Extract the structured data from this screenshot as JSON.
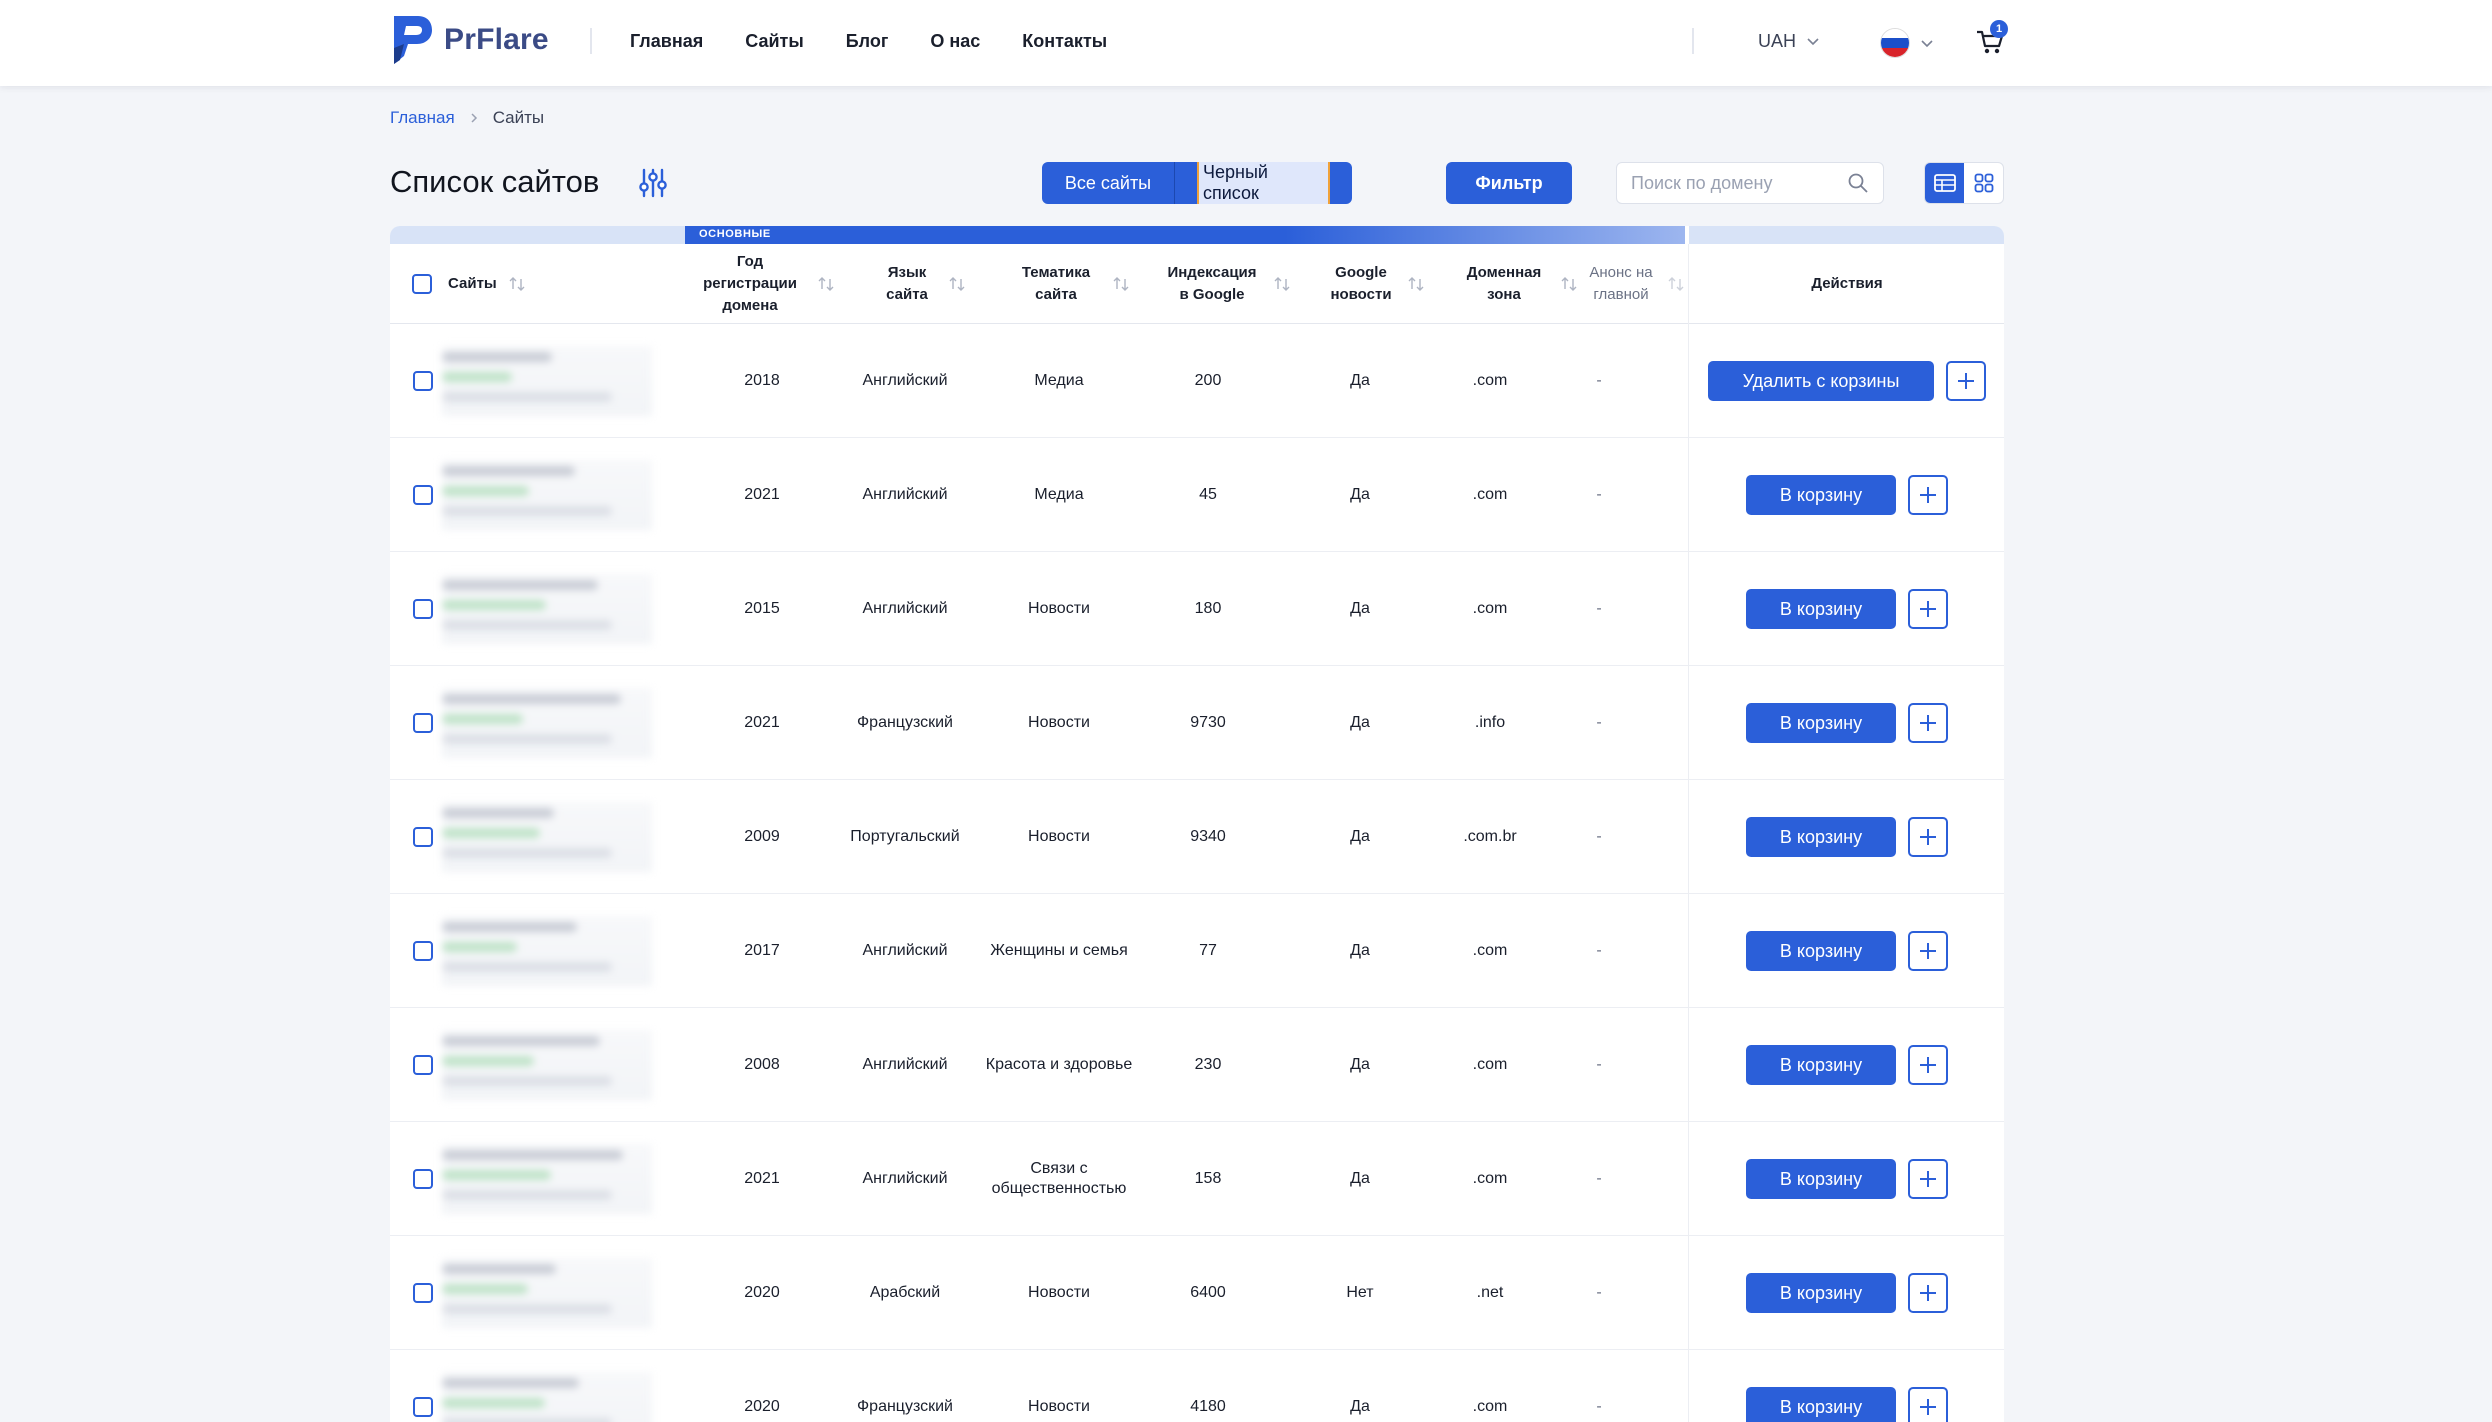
{
  "brand": {
    "name": "PrFlare",
    "accent": "#2b5fd9"
  },
  "nav": [
    "Главная",
    "Сайты",
    "Блог",
    "О нас",
    "Контакты"
  ],
  "currency": "UAH",
  "cart": {
    "count": "1"
  },
  "breadcrumb": {
    "home": "Главная",
    "current": "Сайты"
  },
  "page": {
    "title": "Список сайтов"
  },
  "tabs": {
    "all": "Все сайты",
    "blacklist": "Черный список"
  },
  "filter_label": "Фильтр",
  "search": {
    "placeholder": "Поиск по домену"
  },
  "table": {
    "band_label": "ОСНОВНЫЕ",
    "headers": {
      "sites": "Сайты",
      "reg_year": "Год регистрации домена",
      "language": "Язык сайта",
      "topic": "Тематика сайта",
      "indexation": "Индексация в Google",
      "google_news": "Google новости",
      "zone": "Доменная зона",
      "announce": "Анонс на главной",
      "actions": "Действия"
    },
    "rows": [
      {
        "year": "2018",
        "lang": "Английский",
        "topic": "Медиа",
        "index": "200",
        "news": "Да",
        "zone": ".com",
        "announce": "-",
        "action": "Удалить с корзины"
      },
      {
        "year": "2021",
        "lang": "Английский",
        "topic": "Медиа",
        "index": "45",
        "news": "Да",
        "zone": ".com",
        "announce": "-",
        "action": "В корзину"
      },
      {
        "year": "2015",
        "lang": "Английский",
        "topic": "Новости",
        "index": "180",
        "news": "Да",
        "zone": ".com",
        "announce": "-",
        "action": "В корзину"
      },
      {
        "year": "2021",
        "lang": "Французский",
        "topic": "Новости",
        "index": "9730",
        "news": "Да",
        "zone": ".info",
        "announce": "-",
        "action": "В корзину"
      },
      {
        "year": "2009",
        "lang": "Португальский",
        "topic": "Новости",
        "index": "9340",
        "news": "Да",
        "zone": ".com.br",
        "announce": "-",
        "action": "В корзину"
      },
      {
        "year": "2017",
        "lang": "Английский",
        "topic": "Женщины и семья",
        "index": "77",
        "news": "Да",
        "zone": ".com",
        "announce": "-",
        "action": "В корзину"
      },
      {
        "year": "2008",
        "lang": "Английский",
        "topic": "Красота и здоровье",
        "index": "230",
        "news": "Да",
        "zone": ".com",
        "announce": "-",
        "action": "В корзину"
      },
      {
        "year": "2021",
        "lang": "Английский",
        "topic": "Связи с общественностью",
        "index": "158",
        "news": "Да",
        "zone": ".com",
        "announce": "-",
        "action": "В корзину"
      },
      {
        "year": "2020",
        "lang": "Арабский",
        "topic": "Новости",
        "index": "6400",
        "news": "Нет",
        "zone": ".net",
        "announce": "-",
        "action": "В корзину"
      },
      {
        "year": "2020",
        "lang": "Французский",
        "topic": "Новости",
        "index": "4180",
        "news": "Да",
        "zone": ".com",
        "announce": "-",
        "action": "В корзину"
      }
    ]
  }
}
